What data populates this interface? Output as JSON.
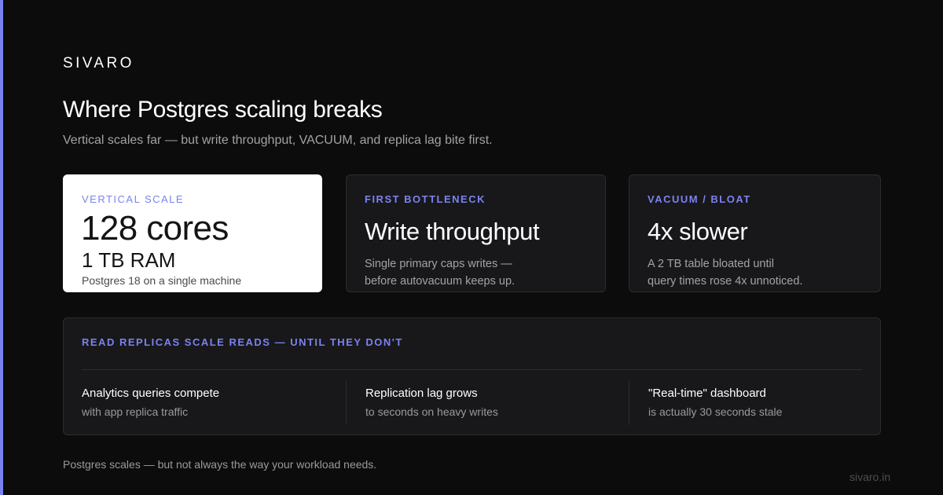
{
  "brand": {
    "name": "SIVARO",
    "url": "sivaro.in"
  },
  "header": {
    "title": "Where Postgres scaling breaks",
    "subtitle": "Vertical scales far — but write throughput, VACUUM, and replica lag bite first."
  },
  "cards": [
    {
      "eyebrow": "VERTICAL SCALE",
      "primary": "128 cores",
      "secondary": "1 TB RAM",
      "caption": "Postgres 18 on a single machine"
    },
    {
      "eyebrow": "FIRST BOTTLENECK",
      "heading": "Write throughput",
      "desc_line1": "Single primary caps writes —",
      "desc_line2": "before autovacuum keeps up."
    },
    {
      "eyebrow": "VACUUM / BLOAT",
      "heading": "4x slower",
      "desc_line1": "A 2 TB table bloated until",
      "desc_line2": "query times rose 4x unnoticed."
    }
  ],
  "replicas": {
    "eyebrow": "READ REPLICAS SCALE READS — UNTIL THEY DON'T",
    "items": [
      {
        "title": "Analytics queries compete",
        "sub": "with app replica traffic"
      },
      {
        "title": "Replication lag grows",
        "sub": "to seconds on heavy writes"
      },
      {
        "title": "\"Real-time\" dashboard",
        "sub": "is actually 30 seconds stale"
      }
    ]
  },
  "footer": {
    "note": "Postgres scales — but not always the way your workload needs."
  },
  "colors": {
    "background": "#0c0c0c",
    "accent": "#7b82f0",
    "card_dark": "#18181a",
    "card_light": "#ffffff"
  }
}
